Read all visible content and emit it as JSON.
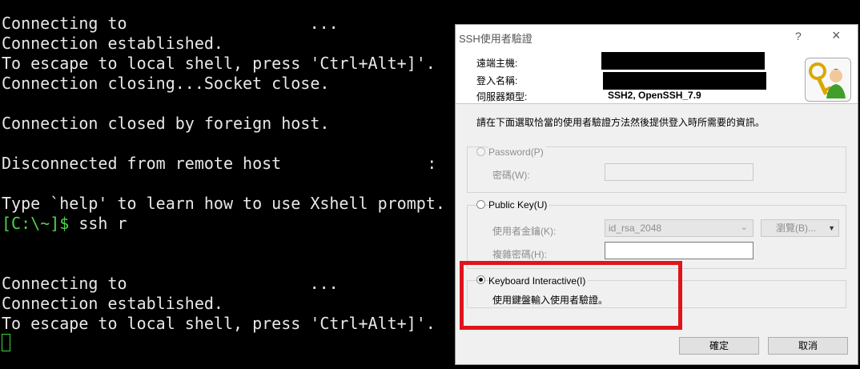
{
  "terminal": {
    "lines": [
      "Connecting to ",
      "Connection established.",
      "To escape to local shell, press 'Ctrl+Alt+]'.",
      "Connection closing...Socket close.",
      "",
      "Connection closed by foreign host.",
      "",
      "Disconnected from remote host",
      "",
      "Type `help' to learn how to use Xshell prompt.",
      "ssh r",
      "",
      "",
      "Connecting to ",
      "Connection established.",
      "To escape to local shell, press 'Ctrl+Alt+]'."
    ],
    "ellipsis": "...",
    "colon": ":",
    "prompt": "[C:\\~]$"
  },
  "dialog": {
    "title": "SSH使用者驗證",
    "help_glyph": "?",
    "close_glyph": "×",
    "remote_host_label": "遠端主機:",
    "login_name_label": "登入名稱:",
    "server_type_label": "伺服器類型:",
    "server_type_value": "SSH2, OpenSSH_7.9",
    "instruction": "請在下面選取恰當的使用者驗證方法然後提供登入時所需要的資訊。",
    "password": {
      "option_label": "Password(P)",
      "field_label": "密碼(W):"
    },
    "public_key": {
      "option_label": "Public Key(U)",
      "user_key_label": "使用者金鑰(K):",
      "user_key_value": "id_rsa_2048",
      "browse_label": "瀏覽(B)...",
      "passphrase_label": "複雜密碼(H):"
    },
    "keyboard_interactive": {
      "option_label": "Keyboard Interactive(I)",
      "description": "使用鍵盤輸入使用者驗證。"
    },
    "ok_label": "確定",
    "cancel_label": "取消"
  },
  "colors": {
    "terminal_bg": "#000000",
    "terminal_text": "#e8e8e8",
    "prompt": "#4fd34f",
    "highlight": "#e0141b",
    "dialog_bg": "#f0f0f0"
  }
}
